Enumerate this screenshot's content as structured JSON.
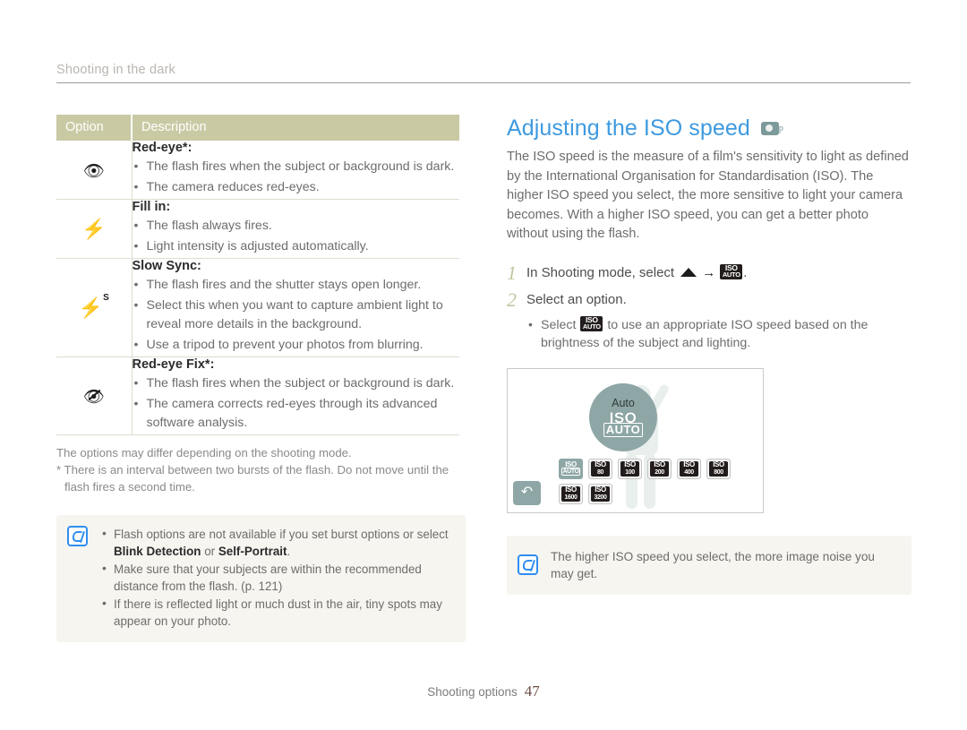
{
  "running_header": {
    "text": "Shooting in the dark"
  },
  "table": {
    "headers": [
      "Option",
      "Description"
    ],
    "rows": [
      {
        "icon": "red-eye-icon",
        "title": "Red-eye",
        "title_star": "*",
        "title_colon": ":",
        "bullets": [
          "The flash fires when the subject or background is dark.",
          "The camera reduces red-eyes."
        ]
      },
      {
        "icon": "flash-fill-in-icon",
        "title": "Fill in",
        "title_star": "",
        "title_colon": ":",
        "bullets": [
          "The flash always fires.",
          "Light intensity is adjusted automatically."
        ]
      },
      {
        "icon": "flash-slow-sync-icon",
        "title": "Slow Sync",
        "title_star": "",
        "title_colon": ":",
        "bullets": [
          "The flash fires and the shutter stays open longer.",
          "Select this when you want to capture ambient light to reveal more details in the background.",
          "Use a tripod to prevent your photos from blurring."
        ]
      },
      {
        "icon": "red-eye-fix-icon",
        "title": "Red-eye Fix",
        "title_star": "*",
        "title_colon": ":",
        "bullets": [
          "The flash fires when the subject or background is dark.",
          "The camera corrects red-eyes through its advanced software analysis."
        ]
      }
    ],
    "footnotes": [
      "The options may differ depending on the shooting mode.",
      "* There is an interval between two bursts of the flash. Do not move until the flash fires a second time."
    ]
  },
  "note_left": {
    "icon": "note-pen-icon",
    "bullets": [
      {
        "pre": "Flash options are not available if you set burst options or select ",
        "bold1": "Blink Detection",
        "mid": " or ",
        "bold2": "Self-Portrait",
        "post": "."
      },
      {
        "pre": "Make sure that your subjects are within the recommended distance from the flash. (p. 121)",
        "bold1": "",
        "mid": "",
        "bold2": "",
        "post": ""
      },
      {
        "pre": "If there is reflected light or much dust in the air, tiny spots may appear on your photo.",
        "bold1": "",
        "mid": "",
        "bold2": "",
        "post": ""
      }
    ]
  },
  "section": {
    "title": "Adjusting the ISO speed",
    "badge_icon": "camera-p-mode-icon",
    "intro": "The ISO speed is the measure of a film's sensitivity to light as defined by the International Organisation for Standardisation (ISO). The higher ISO speed you select, the more sensitive to light your camera becomes. With a higher ISO speed, you can get a better photo without using the flash."
  },
  "steps": [
    {
      "num": "1",
      "text_before": "In Shooting mode, select ",
      "icon_up": "triangle-up-icon",
      "arrow": "→",
      "icon_iso": "iso-auto-icon",
      "text_after": "."
    },
    {
      "num": "2",
      "text_before": "Select an option.",
      "icon_up": "",
      "arrow": "",
      "icon_iso": "",
      "text_after": ""
    }
  ],
  "step2_bullet": {
    "pre": "Select ",
    "icon": "iso-auto-icon",
    "post": " to use an appropriate ISO speed based on the brightness of the subject and lighting."
  },
  "camera_screen": {
    "selected_label": "Auto",
    "selected_iso_top": "ISO",
    "selected_iso_bottom": "AUTO",
    "back_icon": "back-arrow-icon",
    "options": [
      {
        "top": "ISO",
        "bottom": "AUTO",
        "selected": true
      },
      {
        "top": "ISO",
        "bottom": "80",
        "selected": false
      },
      {
        "top": "ISO",
        "bottom": "100",
        "selected": false
      },
      {
        "top": "ISO",
        "bottom": "200",
        "selected": false
      },
      {
        "top": "ISO",
        "bottom": "400",
        "selected": false
      },
      {
        "top": "ISO",
        "bottom": "800",
        "selected": false
      },
      {
        "top": "ISO",
        "bottom": "1600",
        "selected": false
      },
      {
        "top": "ISO",
        "bottom": "3200",
        "selected": false
      }
    ]
  },
  "note_right": {
    "icon": "note-pen-icon",
    "text": "The higher ISO speed you select, the more image noise you may get."
  },
  "footer": {
    "label": "Shooting options",
    "page": "47"
  },
  "colors": {
    "accent_blue": "#3e9ae0",
    "table_header": "#c9c9a4",
    "step_number": "#c5c5a0",
    "note_bg": "#f7f5f0",
    "screen_teal": "#8ea6a6",
    "note_icon_blue": "#2f8ef0",
    "page_number": "#6c4f44"
  }
}
